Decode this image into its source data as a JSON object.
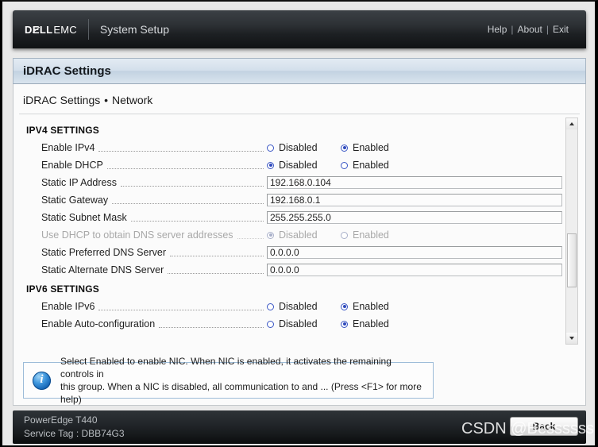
{
  "header": {
    "brand_dell": "D",
    "brand_e": "E",
    "brand_ll": "LL",
    "brand_emc": "EMC",
    "app_title": "System Setup",
    "nav": {
      "help": "Help",
      "divider1": "|",
      "about": "About",
      "divider2": "|",
      "exit": "Exit"
    }
  },
  "page": {
    "band_title": "iDRAC Settings",
    "breadcrumb_root": "iDRAC Settings",
    "breadcrumb_sep": " • ",
    "breadcrumb_leaf": "Network"
  },
  "groups": [
    {
      "title": "IPV4 SETTINGS",
      "rows": [
        {
          "label": "Enable IPv4",
          "type": "radio",
          "options": [
            "Disabled",
            "Enabled"
          ],
          "selected": 1,
          "disabled": false
        },
        {
          "label": "Enable DHCP",
          "type": "radio",
          "options": [
            "Disabled",
            "Enabled"
          ],
          "selected": 0,
          "disabled": false
        },
        {
          "label": "Static IP Address",
          "type": "text",
          "value": "192.168.0.104",
          "disabled": false
        },
        {
          "label": "Static Gateway",
          "type": "text",
          "value": "192.168.0.1",
          "disabled": false
        },
        {
          "label": "Static Subnet Mask",
          "type": "text",
          "value": "255.255.255.0",
          "disabled": false
        },
        {
          "label": "Use DHCP to obtain DNS server addresses",
          "type": "radio",
          "options": [
            "Disabled",
            "Enabled"
          ],
          "selected": 0,
          "disabled": true
        },
        {
          "label": "Static Preferred DNS Server",
          "type": "text",
          "value": "0.0.0.0",
          "disabled": false
        },
        {
          "label": "Static Alternate DNS Server",
          "type": "text",
          "value": "0.0.0.0",
          "disabled": false
        }
      ]
    },
    {
      "title": "IPV6 SETTINGS",
      "rows": [
        {
          "label": "Enable IPv6",
          "type": "radio",
          "options": [
            "Disabled",
            "Enabled"
          ],
          "selected": 1,
          "disabled": false
        },
        {
          "label": "Enable Auto-configuration",
          "type": "radio",
          "options": [
            "Disabled",
            "Enabled"
          ],
          "selected": 1,
          "disabled": false
        }
      ]
    }
  ],
  "help": {
    "line1": "Select Enabled to enable NIC. When NIC is enabled, it activates the remaining controls in",
    "line2": "this group. When a NIC is disabled, all communication to and ... (Press <F1> for more help)"
  },
  "footer": {
    "model": "PowerEdge T440",
    "service_tag": "Service Tag : DBB74G3",
    "back_label": "Back"
  },
  "watermark": "CSDN @Bessssss",
  "colors": {
    "accent_blue": "#2f49bb",
    "band_blue": "#c2d2e1",
    "info_blue": "#1565b5"
  }
}
